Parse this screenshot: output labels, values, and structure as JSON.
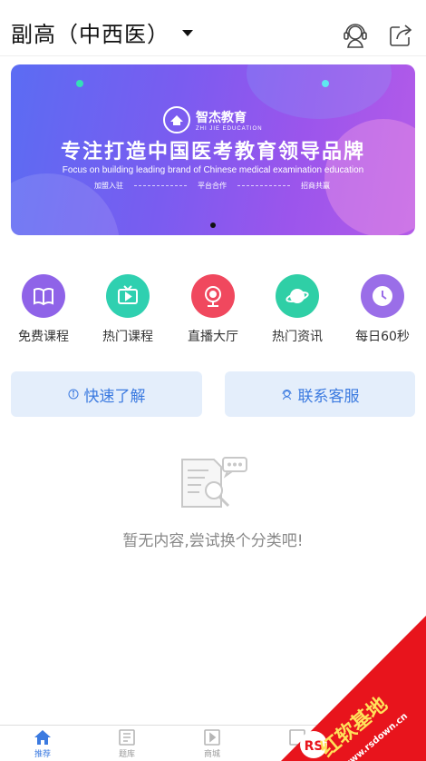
{
  "header": {
    "title": "副高（中西医）",
    "icons": [
      "support-icon",
      "share-icon"
    ]
  },
  "banner": {
    "brand_name": "智杰教育",
    "brand_sub": "ZHI JIE EDUCATION",
    "slogan": "专注打造中国医考教育领导品牌",
    "slogan_en": "Focus on building leading brand of Chinese medical examination education",
    "tags": [
      "加盟入驻",
      "平台合作",
      "招商共赢"
    ],
    "colors": {
      "start": "#5b6cf3",
      "end": "#b45be8"
    }
  },
  "categories": [
    {
      "label": "免费课程",
      "icon": "book-icon",
      "color": "#8f63e8"
    },
    {
      "label": "热门课程",
      "icon": "tv-play-icon",
      "color": "#2fd0b0"
    },
    {
      "label": "直播大厅",
      "icon": "webcam-icon",
      "color": "#f0485e"
    },
    {
      "label": "热门资讯",
      "icon": "planet-icon",
      "color": "#2fcfa6"
    },
    {
      "label": "每日60秒",
      "icon": "clock-icon",
      "color": "#9a6ee8"
    }
  ],
  "actions": {
    "quick_learn": "快速了解",
    "contact_service": "联系客服",
    "accent": "#3b7ae0"
  },
  "empty": {
    "text": "暂无内容,尝试换个分类吧!"
  },
  "tabbar": {
    "tabs": [
      {
        "label": "推荐",
        "icon": "home-icon",
        "active": true
      },
      {
        "label": "题库",
        "icon": "question-bank-icon",
        "active": false
      },
      {
        "label": "商城",
        "icon": "video-shop-icon",
        "active": false
      },
      {
        "label": "",
        "icon": "tab-icon",
        "active": false
      }
    ]
  },
  "watermark": {
    "brand": "红软基地",
    "url": "www.rsdown.cn"
  }
}
